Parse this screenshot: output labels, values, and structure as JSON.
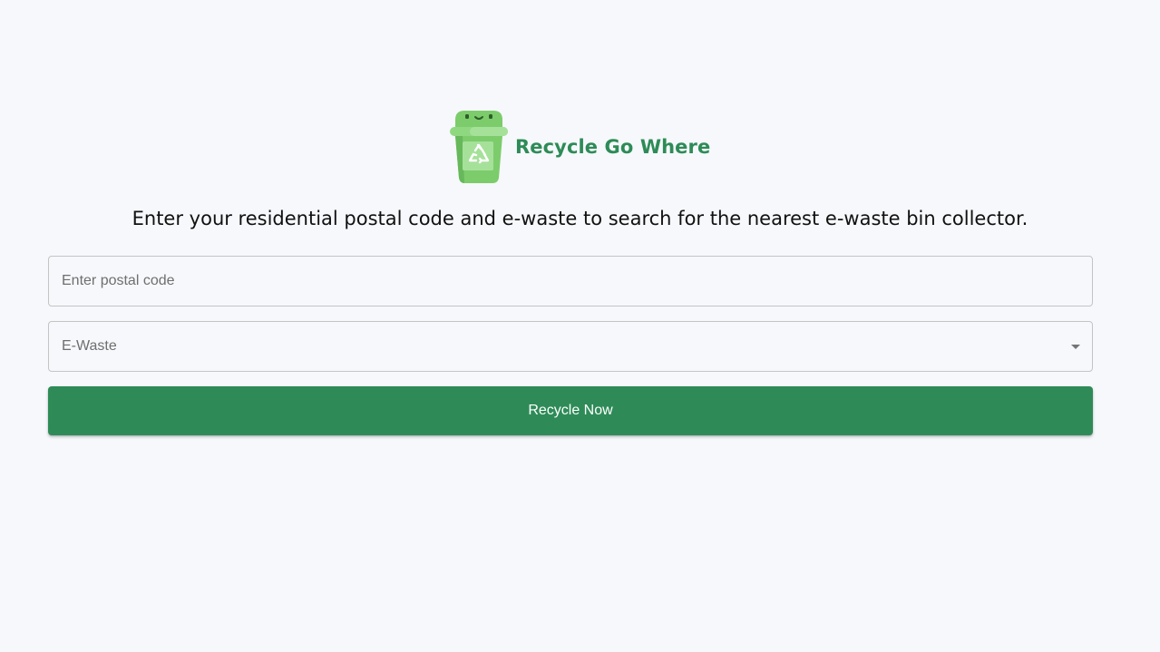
{
  "brand": {
    "name": "Recycle Go Where",
    "logo_icon": "recycle-bin-icon"
  },
  "headline": "Enter your residential postal code and e-waste to search for the nearest e-waste bin collector.",
  "postal_field": {
    "placeholder": "Enter postal code",
    "value": ""
  },
  "ewaste_select": {
    "label": "E-Waste",
    "selected": "",
    "icon": "chevron-down-icon"
  },
  "submit_button": {
    "label": "Recycle Now"
  },
  "colors": {
    "accent": "#2e8b57",
    "background": "#f6f8fb",
    "bin_green": "#7ccc6c"
  }
}
